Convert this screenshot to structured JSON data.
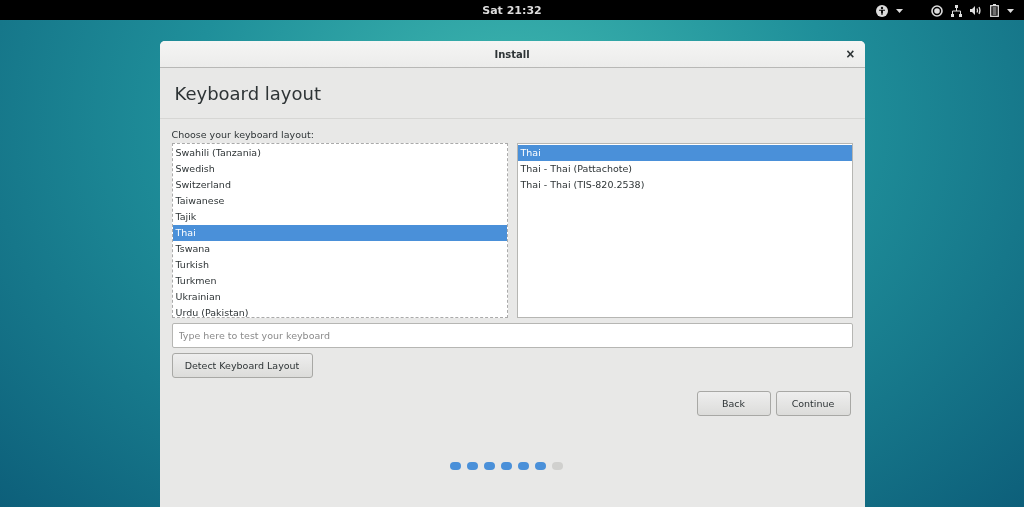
{
  "top_bar": {
    "clock": "Sat 21:32"
  },
  "window": {
    "title": "Install",
    "close": "×"
  },
  "header": {
    "title": "Keyboard layout"
  },
  "layout_label": "Choose your keyboard layout:",
  "layouts": [
    {
      "label": "Swahili (Tanzania)",
      "selected": false
    },
    {
      "label": "Swedish",
      "selected": false
    },
    {
      "label": "Switzerland",
      "selected": false
    },
    {
      "label": "Taiwanese",
      "selected": false
    },
    {
      "label": "Tajik",
      "selected": false
    },
    {
      "label": "Thai",
      "selected": true
    },
    {
      "label": "Tswana",
      "selected": false
    },
    {
      "label": "Turkish",
      "selected": false
    },
    {
      "label": "Turkmen",
      "selected": false
    },
    {
      "label": "Ukrainian",
      "selected": false
    },
    {
      "label": "Urdu (Pakistan)",
      "selected": false
    }
  ],
  "variants": [
    {
      "label": "Thai",
      "selected": true
    },
    {
      "label": "Thai - Thai (Pattachote)",
      "selected": false
    },
    {
      "label": "Thai - Thai (TIS-820.2538)",
      "selected": false
    }
  ],
  "test_field": {
    "placeholder": "Type here to test your keyboard"
  },
  "detect_button": "Detect Keyboard Layout",
  "buttons": [
    "Back",
    "Continue"
  ],
  "progress": [
    {
      "done": true
    },
    {
      "done": true
    },
    {
      "done": true
    },
    {
      "done": true
    },
    {
      "done": true
    },
    {
      "done": true
    },
    {
      "done": false
    }
  ]
}
